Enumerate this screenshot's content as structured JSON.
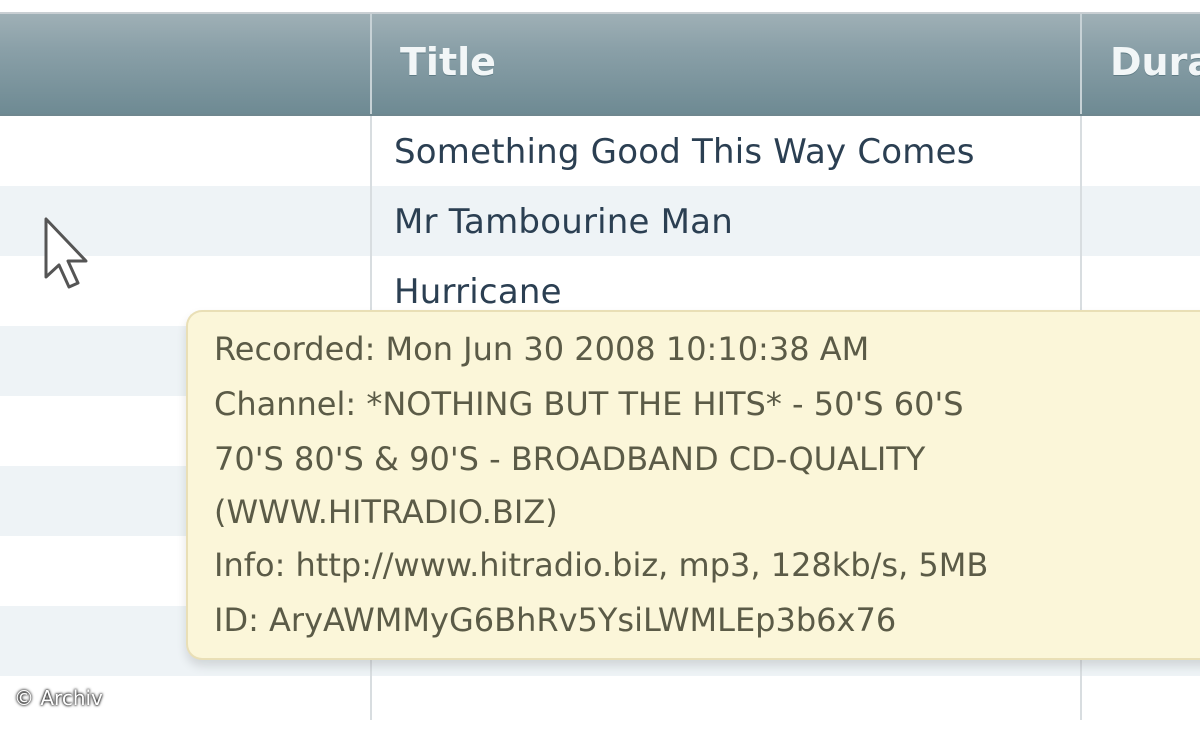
{
  "table": {
    "columns": [
      {
        "label": ""
      },
      {
        "label": "Title"
      },
      {
        "label": "Dura"
      }
    ],
    "rows": [
      {
        "title": "Something Good This Way Comes"
      },
      {
        "title": "Mr Tambourine Man"
      },
      {
        "title": "Hurricane"
      },
      {
        "title": ""
      },
      {
        "title": ""
      },
      {
        "title": ""
      },
      {
        "title": ""
      },
      {
        "title": ""
      },
      {
        "title": ""
      }
    ]
  },
  "tooltip": {
    "recorded": "Recorded: Mon Jun 30 2008 10:10:38 AM",
    "channel_line1": "Channel: *NOTHING BUT THE HITS* - 50'S 60'S",
    "channel_line2": "70'S 80'S & 90'S - BROADBAND CD-QUALITY",
    "channel_line3": "(WWW.HITRADIO.BIZ)",
    "info": "Info: http://www.hitradio.biz, mp3, 128kb/s, 5MB",
    "id": "ID: AryAWMMyG6BhRv5YsiLWMLEp3b6x76"
  },
  "watermark": "© Archiv",
  "colors": {
    "header_bg": "#8aa0a8",
    "row_alt": "#eef3f6",
    "tooltip_bg": "#fbf6d9",
    "title_text": "#2b3f52"
  },
  "icons": {
    "cursor": "mouse-pointer-icon"
  }
}
